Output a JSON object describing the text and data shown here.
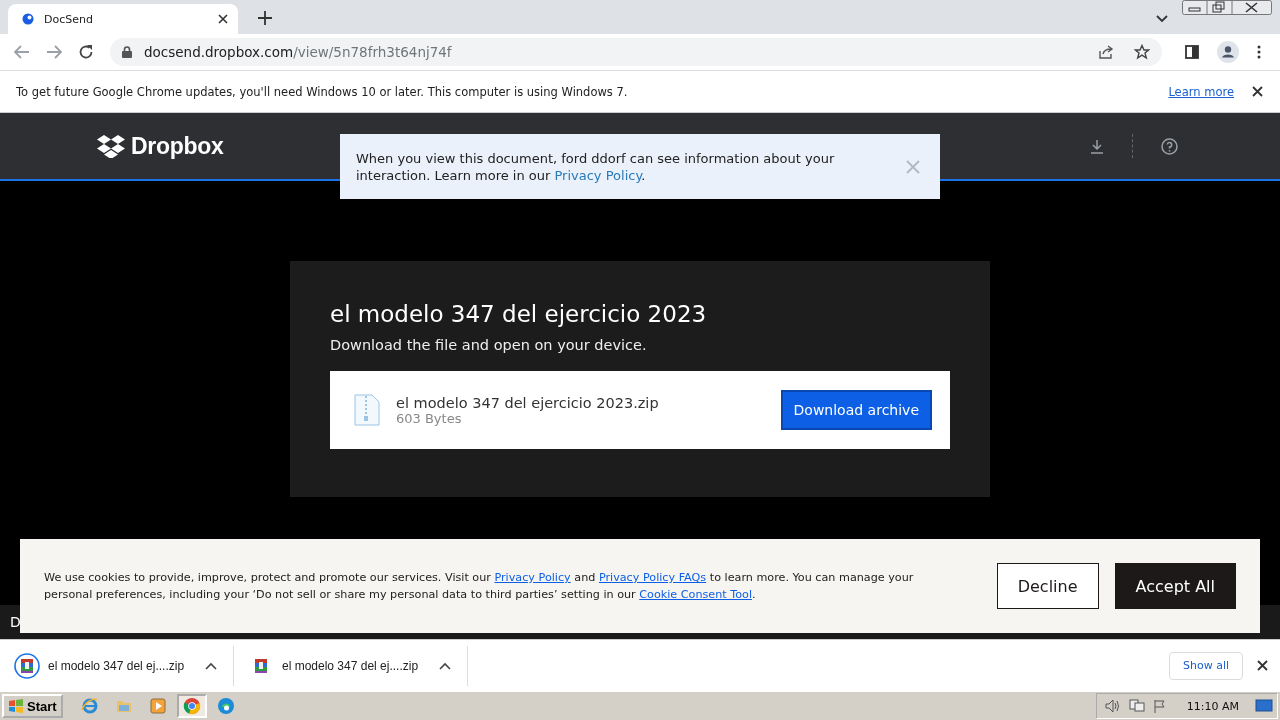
{
  "browser": {
    "tab": {
      "title": "DocSend",
      "selected": true
    },
    "url": {
      "host": "docsend.dropbox.com",
      "path": "/view/5n78frh3t64nj74f"
    },
    "infobar": {
      "message": "To get future Google Chrome updates, you'll need Windows 10 or later. This computer is using Windows 7.",
      "link": "Learn more"
    }
  },
  "header": {
    "logo": "Dropbox"
  },
  "notice": {
    "parts": [
      {
        "kind": "text",
        "text": "When you view this document, ford ddorf can see information about your interaction. Learn more in our "
      },
      {
        "kind": "link",
        "text": "Privacy Policy"
      },
      {
        "kind": "text",
        "text": "."
      }
    ]
  },
  "card": {
    "title": "el modelo 347 del ejercicio 2023",
    "subtitle": "Download the file and open on your device.",
    "file": {
      "name": "el modelo 347 del ejercicio 2023.zip",
      "size": "603 Bytes"
    },
    "button": "Download archive"
  },
  "footer_text": "D",
  "cookie_banner": {
    "parts": [
      {
        "kind": "text",
        "text": "We use cookies to provide, improve, protect and promote our services. Visit our "
      },
      {
        "kind": "link",
        "text": "Privacy Policy"
      },
      {
        "kind": "text",
        "text": " and "
      },
      {
        "kind": "link",
        "text": "Privacy Policy FAQs"
      },
      {
        "kind": "text",
        "text": " to learn more. You can manage your personal preferences, including your ‘Do not sell or share my personal data to third parties’ setting in our "
      },
      {
        "kind": "link",
        "text": "Cookie Consent Tool"
      },
      {
        "kind": "text",
        "text": "."
      }
    ],
    "buttons": [
      {
        "label": "Decline",
        "kind": "outline"
      },
      {
        "label": "Accept All",
        "kind": "filled"
      }
    ]
  },
  "downloads": {
    "items": [
      {
        "name": "el modelo 347 del ej....zip",
        "highlighted": true
      },
      {
        "name": "el modelo 347 del ej....zip",
        "highlighted": false
      }
    ],
    "show_all": "Show all"
  },
  "taskbar": {
    "start": "Start",
    "apps": [
      {
        "kind": "ie",
        "selected": false
      },
      {
        "kind": "folder",
        "selected": false
      },
      {
        "kind": "media",
        "selected": false
      },
      {
        "kind": "chrome",
        "selected": true
      },
      {
        "kind": "edge",
        "selected": false
      }
    ],
    "clock": "11:10 AM"
  }
}
